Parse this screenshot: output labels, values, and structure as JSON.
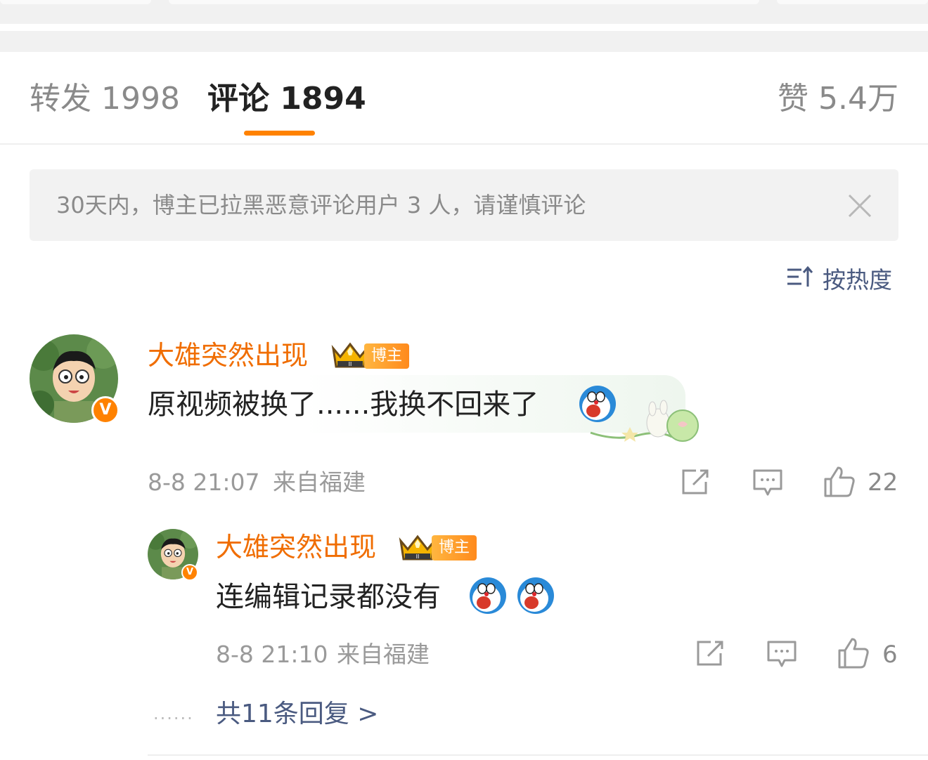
{
  "tabs": {
    "repost": "转发 1998",
    "comments": "评论 1894",
    "likes": "赞 5.4万"
  },
  "notice": {
    "text": "30天内，博主已拉黑恶意评论用户 3 人，请谨慎评论",
    "close_icon": "close-icon"
  },
  "sort": {
    "label": "按热度",
    "icon": "sort-icon"
  },
  "colors": {
    "accent": "#ff8200",
    "username": "#f06d00",
    "link": "#4a5a80",
    "muted": "#9a9a9a"
  },
  "comment": {
    "username": "大雄突然出现",
    "tag": "博主",
    "text": "原视频被换了......我换不回来了",
    "time": "8-8 21:07",
    "location": "来自福建",
    "likes": "22"
  },
  "reply": {
    "username": "大雄突然出现",
    "tag": "博主",
    "text": "连编辑记录都没有",
    "time": "8-8 21:10",
    "location": "来自福建",
    "likes": "6"
  },
  "more_replies": {
    "dots": "......",
    "label": "共11条回复 >"
  }
}
